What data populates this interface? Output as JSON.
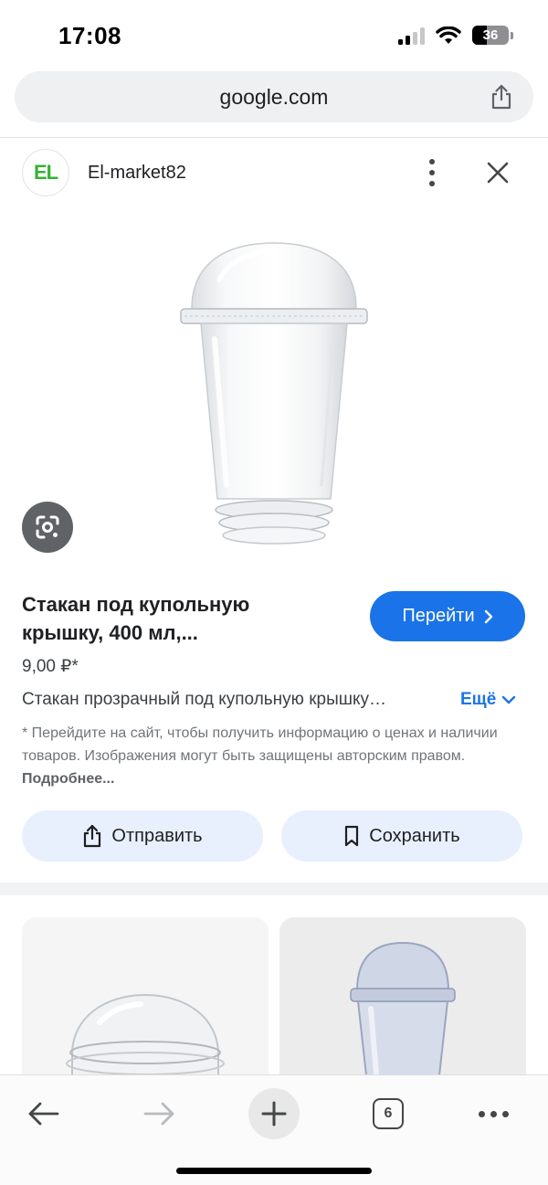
{
  "status_bar": {
    "time": "17:08",
    "battery": "36"
  },
  "browser": {
    "url": "google.com"
  },
  "result": {
    "site_logo_text": "EL",
    "site_name": "El-market82",
    "title_line1": "Стакан под купольную",
    "title_line2": "крышку, 400 мл,...",
    "visit_label": "Перейти",
    "price": "9,00 ₽*",
    "description": "Стакан прозрачный под купольную крышку…",
    "more_label": "Ещё",
    "disclaimer": "* Перейдите на сайт, чтобы получить информацию о ценах и наличии товаров. Изображения могут быть защищены авторским правом.",
    "disclaimer_link": "Подробнее...",
    "send_label": "Отправить",
    "save_label": "Сохранить"
  },
  "toolbar": {
    "tab_count": "6"
  },
  "icons": {
    "share": "share-icon",
    "more": "more-vert-icon",
    "close": "close-icon",
    "lens": "lens-icon",
    "back": "arrow-back-icon",
    "forward": "arrow-forward-icon",
    "new_tab": "plus-icon",
    "menu": "more-horiz-icon",
    "bookmark": "bookmark-icon"
  },
  "colors": {
    "accent": "#1a73e8",
    "action_button_bg": "#e8f0fe",
    "logo_green": "#33b332"
  }
}
